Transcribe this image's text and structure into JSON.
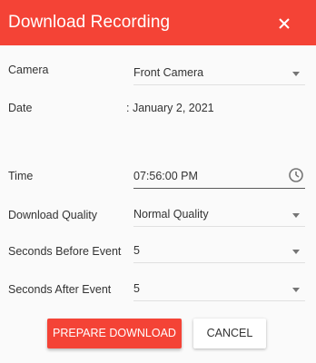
{
  "dialog": {
    "title": "Download Recording",
    "close_icon": "close-icon",
    "accent_color": "#f44336"
  },
  "form": {
    "camera": {
      "label": "Camera",
      "value": "Front Camera"
    },
    "date": {
      "label": "Date",
      "value": ": January 2, 2021"
    },
    "time": {
      "label": "Time",
      "value": "07:56:00 PM",
      "icon": "clock-icon"
    },
    "quality": {
      "label": "Download Quality",
      "value": "Normal Quality"
    },
    "before": {
      "label": "Seconds Before Event",
      "value": "5"
    },
    "after": {
      "label": "Seconds After Event",
      "value": "5"
    }
  },
  "actions": {
    "prepare_label": "PREPARE DOWNLOAD",
    "cancel_label": "CANCEL"
  }
}
